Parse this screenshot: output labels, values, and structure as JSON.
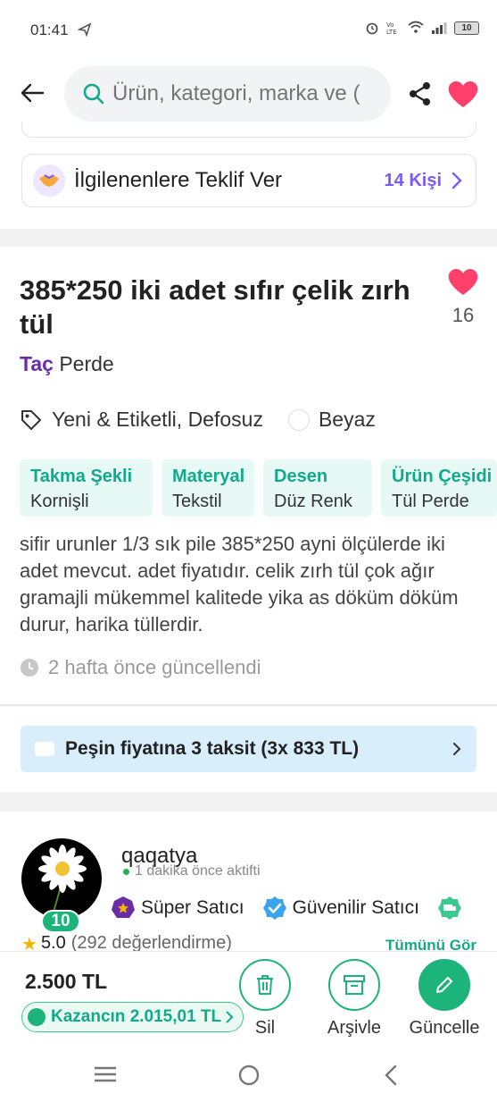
{
  "status_bar": {
    "time": "01:41",
    "battery": "10"
  },
  "search": {
    "placeholder": "Ürün, kategori, marka ve ("
  },
  "offer": {
    "title": "İlgilenenlere Teklif Ver",
    "count": "14 Kişi"
  },
  "product": {
    "title": "385*250 iki adet sıfır çelik zırh tül",
    "favorite_count": "16",
    "brand_highlight": "Taç",
    "brand_rest": " Perde",
    "condition": "Yeni & Etiketli, Defosuz",
    "color": "Beyaz",
    "attributes": [
      {
        "key": "Takma Şekli",
        "value": "Kornişli"
      },
      {
        "key": "Materyal",
        "value": "Tekstil"
      },
      {
        "key": "Desen",
        "value": "Düz Renk"
      },
      {
        "key": "Ürün Çeşidi",
        "value": "Tül Perde"
      }
    ],
    "description": "sifir urunler 1/3 sık pile 385*250 ayni ölçülerde iki adet mevcut. adet fiyatıdır. celik zırh tül çok ağır gramajli mükemmel kalitede yika as döküm döküm durur, harika tüllerdir.",
    "updated": "2 hafta önce güncellendi"
  },
  "installment": {
    "text": "Peşin fiyatına 3 taksit (3x 833 TL)"
  },
  "seller": {
    "username": "qaqatya",
    "active": "1 dakika önce aktifti",
    "level": "10",
    "badges": [
      "Süper Satıcı",
      "Güvenilir Satıcı"
    ],
    "rating": "5.0",
    "rating_count": "(292 değerlendirme)",
    "see_all": "Tümünü Gör"
  },
  "bottom": {
    "price": "2.500 TL",
    "earn": "Kazancın 2.015,01 TL",
    "actions": [
      "Sil",
      "Arşivle",
      "Güncelle"
    ]
  },
  "colors": {
    "accent_green": "#1cb47a",
    "heart_pink": "#ff3f6c",
    "brand_purple": "#6a2da8",
    "offer_purple": "#7a5af8"
  }
}
